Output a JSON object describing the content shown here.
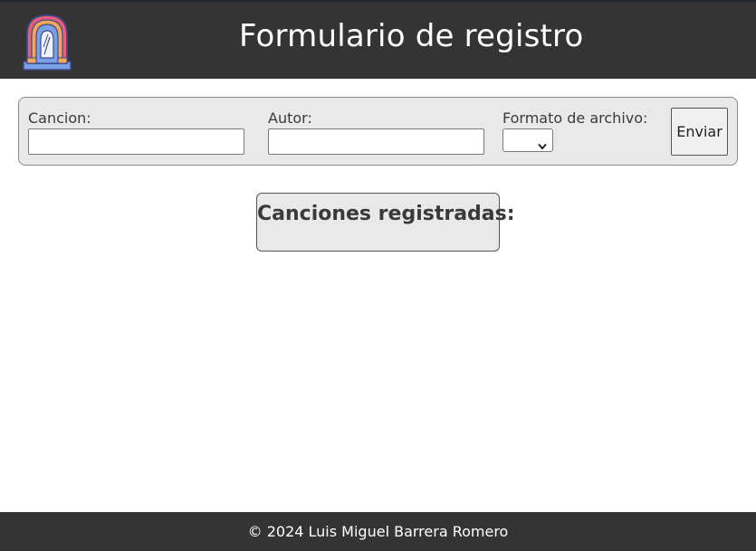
{
  "header": {
    "title": "Formulario de registro",
    "logo_icon": "jukebox-icon"
  },
  "form": {
    "song_label": "Cancion:",
    "song_value": "",
    "author_label": "Autor:",
    "author_value": "",
    "format_label": "Formato de archivo:",
    "format_selected": "",
    "submit_label": "Enviar"
  },
  "songs": {
    "title": "Canciones registradas:"
  },
  "footer": {
    "text": "© 2024 Luis Miguel Barrera Romero"
  },
  "colors": {
    "header_bg": "#343434",
    "panel_bg": "#e9e9e9",
    "text": "#3a3a3a"
  }
}
